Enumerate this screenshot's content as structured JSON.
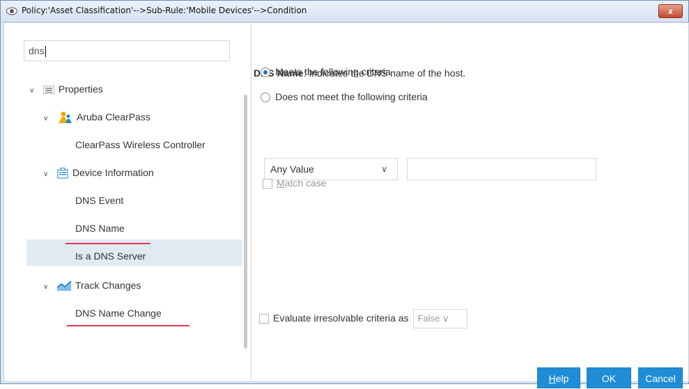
{
  "window": {
    "title": "Policy:'Asset Classification'-->Sub-Rule:'Mobile Devices'-->Condition",
    "close_label": "x"
  },
  "search": {
    "value": "dns"
  },
  "tree": {
    "properties": "Properties",
    "aruba": "Aruba ClearPass",
    "clearpass_controller": "ClearPass Wireless Controller",
    "device_information": "Device Information",
    "dns_event": "DNS Event",
    "dns_name": "DNS Name",
    "is_dns_server": "Is a DNS Server",
    "track_changes": "Track Changes",
    "dns_name_change": "DNS Name Change"
  },
  "detail": {
    "name": "DNS Name",
    "description": ": Indicates the DNS name of the host.",
    "radio_meets": "Meets the following criteria",
    "radio_not_meets": "Does not meet the following criteria",
    "selected_radio": "meets",
    "operator": "Any Value",
    "value_field": "",
    "match_case_prefix": "M",
    "match_case_rest": "atch case",
    "evaluate_label": "Evaluate irresolvable criteria as",
    "evaluate_value": "False"
  },
  "buttons": {
    "help_mnemonic": "H",
    "help_rest": "elp",
    "ok": "OK",
    "cancel": "Cancel"
  },
  "colors": {
    "accent_button": "#1f8dd6",
    "selection": "#dfeaf3",
    "underline": "#e03a4a",
    "radio_dot": "#1a6fd1"
  },
  "icons": {
    "title": "eye-icon",
    "properties": "list-icon",
    "aruba": "people-icon",
    "device": "device-card-icon",
    "track": "chart-icon"
  }
}
